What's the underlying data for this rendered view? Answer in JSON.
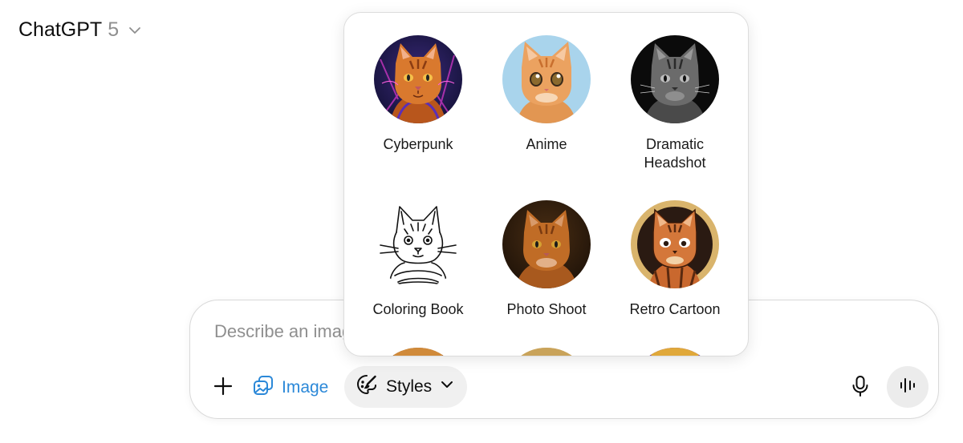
{
  "header": {
    "app_name": "ChatGPT",
    "model_version": "5"
  },
  "composer": {
    "placeholder": "Describe an image",
    "image_label": "Image",
    "styles_label": "Styles"
  },
  "styles_menu": {
    "items": [
      {
        "label": "Cyberpunk",
        "thumb": "cyberpunk-cat-thumbnail"
      },
      {
        "label": "Anime",
        "thumb": "anime-cat-thumbnail"
      },
      {
        "label": "Dramatic\nHeadshot",
        "thumb": "dramatic-headshot-cat-thumbnail"
      },
      {
        "label": "Coloring Book",
        "thumb": "coloring-book-cat-thumbnail"
      },
      {
        "label": "Photo Shoot",
        "thumb": "photo-shoot-cat-thumbnail"
      },
      {
        "label": "Retro Cartoon",
        "thumb": "retro-cartoon-cat-thumbnail"
      }
    ]
  },
  "colors": {
    "accent_blue": "#2b88d8",
    "muted_text": "#8f8f8f",
    "chip_background": "#f0f0f0"
  }
}
